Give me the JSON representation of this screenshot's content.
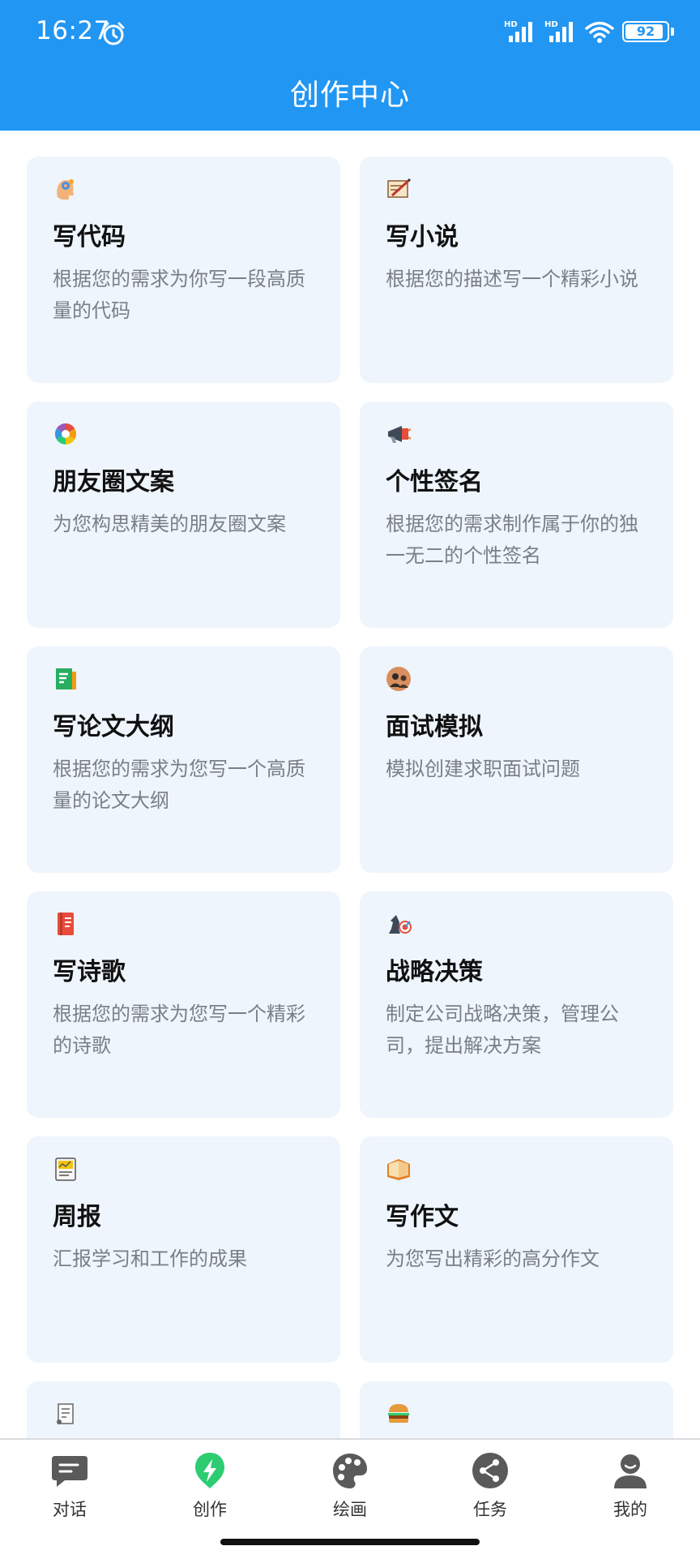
{
  "status_bar": {
    "time": "16:27",
    "network_1": "HD",
    "network_2": "HD",
    "battery": "92"
  },
  "header": {
    "title": "创作中心"
  },
  "cards": [
    {
      "icon": "brain-gear-icon",
      "title": "写代码",
      "desc": "根据您的需求为你写一段高质量的代码"
    },
    {
      "icon": "pen-note-icon",
      "title": "写小说",
      "desc": "根据您的描述写一个精彩小说"
    },
    {
      "icon": "aperture-icon",
      "title": "朋友圈文案",
      "desc": "为您构思精美的朋友圈文案"
    },
    {
      "icon": "megaphone-icon",
      "title": "个性签名",
      "desc": "根据您的需求制作属于你的独一无二的个性签名"
    },
    {
      "icon": "document-icon",
      "title": "写论文大纲",
      "desc": "根据您的需求为您写一个高质量的论文大纲"
    },
    {
      "icon": "interview-icon",
      "title": "面试模拟",
      "desc": "模拟创建求职面试问题"
    },
    {
      "icon": "notebook-icon",
      "title": "写诗歌",
      "desc": "根据您的需求为您写一个精彩的诗歌"
    },
    {
      "icon": "chess-target-icon",
      "title": "战略决策",
      "desc": "制定公司战略决策，管理公司，提出解决方案"
    },
    {
      "icon": "report-chart-icon",
      "title": "周报",
      "desc": "汇报学习和工作的成果"
    },
    {
      "icon": "open-book-icon",
      "title": "写作文",
      "desc": "为您写出精彩的高分作文"
    },
    {
      "icon": "scroll-icon",
      "title": "",
      "desc": ""
    },
    {
      "icon": "burger-icon",
      "title": "",
      "desc": ""
    }
  ],
  "nav": [
    {
      "label": "对话",
      "icon": "chat-icon",
      "active": false
    },
    {
      "label": "创作",
      "icon": "lightning-icon",
      "active": true
    },
    {
      "label": "绘画",
      "icon": "palette-icon",
      "active": false
    },
    {
      "label": "任务",
      "icon": "share-icon",
      "active": false
    },
    {
      "label": "我的",
      "icon": "user-icon",
      "active": false
    }
  ],
  "colors": {
    "header": "#2196f3",
    "card_bg": "#eef5fd",
    "active_nav": "#2ecc71",
    "inactive_nav": "#5a5a5a"
  }
}
